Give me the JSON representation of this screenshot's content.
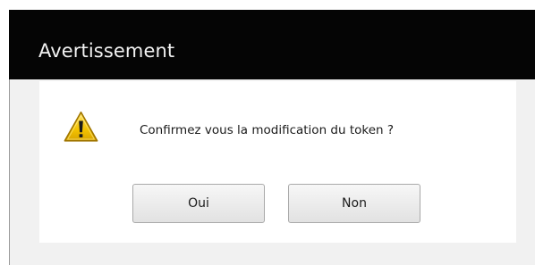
{
  "dialog": {
    "title": "Avertissement",
    "message": "Confirmez vous la modification du token ?",
    "icon": "warning-icon",
    "buttons": {
      "yes_label": "Oui",
      "no_label": "Non"
    }
  },
  "colors": {
    "titlebar_bg": "#050505",
    "title_text": "#f2f2f2",
    "dialog_bg": "#f1f1f1",
    "panel_bg": "#ffffff",
    "warning_fill": "#f2c400",
    "warning_border": "#b88a00"
  }
}
